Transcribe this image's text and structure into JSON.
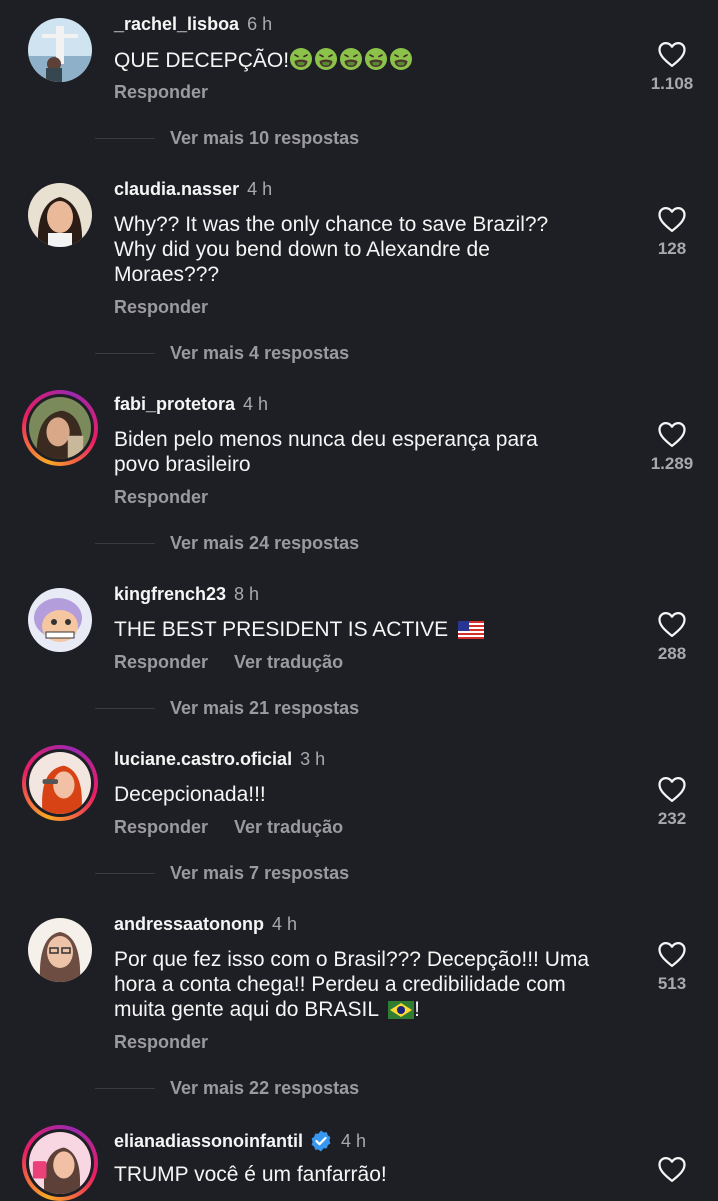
{
  "comments": [
    {
      "username": "_rachel_lisboa",
      "time": "6 h",
      "text": "QUE DECEPÇÃO!",
      "reply": "Responder",
      "likes": "1.108",
      "more": "Ver mais 10 respostas"
    },
    {
      "username": "claudia.nasser",
      "time": "4 h",
      "text_lines": [
        "Why?? It was the only chance to save Brazil??",
        "Why did you bend down to Alexandre de",
        "Moraes???"
      ],
      "reply": "Responder",
      "likes": "128",
      "more": "Ver mais 4 respostas"
    },
    {
      "username": "fabi_protetora",
      "time": "4 h",
      "text_lines": [
        "Biden pelo menos nunca deu esperança para",
        "povo brasileiro"
      ],
      "reply": "Responder",
      "likes": "1.289",
      "more": "Ver mais 24 respostas"
    },
    {
      "username": "kingfrench23",
      "time": "8 h",
      "text": "THE BEST PRESIDENT IS ACTIVE",
      "reply": "Responder",
      "translate": "Ver tradução",
      "likes": "288",
      "more": "Ver mais 21 respostas"
    },
    {
      "username": "luciane.castro.oficial",
      "time": "3 h",
      "text": "Decepcionada!!!",
      "reply": "Responder",
      "translate": "Ver tradução",
      "likes": "232",
      "more": "Ver mais 7 respostas"
    },
    {
      "username": "andressaatononp",
      "time": "4 h",
      "text_lines": [
        "Por que fez isso com o Brasil??? Decepção!!! Uma",
        "hora a conta chega!! Perdeu a credibilidade com",
        "muita gente aqui do BRASIL"
      ],
      "text_tail": "!",
      "reply": "Responder",
      "likes": "513",
      "more": "Ver mais 22 respostas"
    },
    {
      "username": "elianadiassonoinfantil",
      "time": "4 h",
      "text": "TRUMP você é um fanfarrão!"
    }
  ],
  "colors": {
    "background": "#1e1f24",
    "text": "#f5f5f5",
    "muted": "#9a9aa0",
    "verified": "#3897f0"
  },
  "icons": {
    "like": "heart-outline-icon",
    "verified": "verified-badge-icon",
    "emoji": "nauseated-face-emoji",
    "flag_us": "us-flag-emoji",
    "flag_br": "brazil-flag-emoji"
  }
}
